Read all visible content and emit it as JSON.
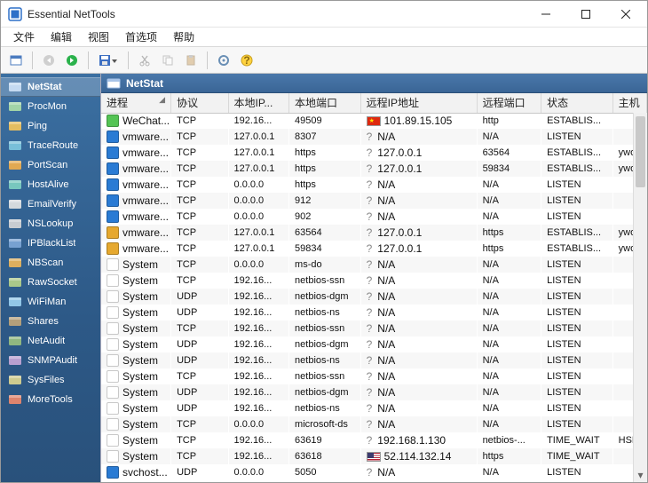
{
  "window": {
    "title": "Essential NetTools"
  },
  "menu": [
    "文件",
    "编辑",
    "视图",
    "首选项",
    "帮助"
  ],
  "panel": {
    "title": "NetStat"
  },
  "sidebar": {
    "items": [
      {
        "label": "NetStat",
        "icon": "netstat-icon",
        "active": true
      },
      {
        "label": "ProcMon",
        "icon": "procmon-icon"
      },
      {
        "label": "Ping",
        "icon": "ping-icon"
      },
      {
        "label": "TraceRoute",
        "icon": "traceroute-icon"
      },
      {
        "label": "PortScan",
        "icon": "portscan-icon"
      },
      {
        "label": "HostAlive",
        "icon": "hostalive-icon"
      },
      {
        "label": "EmailVerify",
        "icon": "emailverify-icon"
      },
      {
        "label": "NSLookup",
        "icon": "nslookup-icon"
      },
      {
        "label": "IPBlackList",
        "icon": "ipblacklist-icon"
      },
      {
        "label": "NBScan",
        "icon": "nbscan-icon"
      },
      {
        "label": "RawSocket",
        "icon": "rawsocket-icon"
      },
      {
        "label": "WiFiMan",
        "icon": "wifiman-icon"
      },
      {
        "label": "Shares",
        "icon": "shares-icon"
      },
      {
        "label": "NetAudit",
        "icon": "netaudit-icon"
      },
      {
        "label": "SNMPAudit",
        "icon": "snmpaudit-icon"
      },
      {
        "label": "SysFiles",
        "icon": "sysfiles-icon"
      },
      {
        "label": "MoreTools",
        "icon": "moretools-icon"
      }
    ]
  },
  "columns": [
    "进程",
    "协议",
    "本地IP...",
    "本地端口",
    "远程IP地址",
    "远程端口",
    "状态",
    "主机"
  ],
  "rows": [
    {
      "picon": "#54c454",
      "proc": "WeChat...",
      "proto": "TCP",
      "lip": "192.16...",
      "lport": "49509",
      "flag": "cn",
      "rip": "101.89.15.105",
      "rport": "http",
      "state": "ESTABLIS...",
      "host": ""
    },
    {
      "picon": "#2a7bd4",
      "proc": "vmware...",
      "proto": "TCP",
      "lip": "127.0.0.1",
      "lport": "8307",
      "flag": "q",
      "rip": "N/A",
      "rport": "N/A",
      "state": "LISTEN",
      "host": ""
    },
    {
      "picon": "#2a7bd4",
      "proc": "vmware...",
      "proto": "TCP",
      "lip": "127.0.0.1",
      "lport": "https",
      "flag": "q",
      "rip": "127.0.0.1",
      "rport": "63564",
      "state": "ESTABLIS...",
      "host": "ywo"
    },
    {
      "picon": "#2a7bd4",
      "proc": "vmware...",
      "proto": "TCP",
      "lip": "127.0.0.1",
      "lport": "https",
      "flag": "q",
      "rip": "127.0.0.1",
      "rport": "59834",
      "state": "ESTABLIS...",
      "host": "ywo"
    },
    {
      "picon": "#2a7bd4",
      "proc": "vmware...",
      "proto": "TCP",
      "lip": "0.0.0.0",
      "lport": "https",
      "flag": "q",
      "rip": "N/A",
      "rport": "N/A",
      "state": "LISTEN",
      "host": ""
    },
    {
      "picon": "#2a7bd4",
      "proc": "vmware...",
      "proto": "TCP",
      "lip": "0.0.0.0",
      "lport": "912",
      "flag": "q",
      "rip": "N/A",
      "rport": "N/A",
      "state": "LISTEN",
      "host": ""
    },
    {
      "picon": "#2a7bd4",
      "proc": "vmware...",
      "proto": "TCP",
      "lip": "0.0.0.0",
      "lport": "902",
      "flag": "q",
      "rip": "N/A",
      "rport": "N/A",
      "state": "LISTEN",
      "host": ""
    },
    {
      "picon": "#e6a82e",
      "proc": "vmware...",
      "proto": "TCP",
      "lip": "127.0.0.1",
      "lport": "63564",
      "flag": "q",
      "rip": "127.0.0.1",
      "rport": "https",
      "state": "ESTABLIS...",
      "host": "ywo"
    },
    {
      "picon": "#e6a82e",
      "proc": "vmware...",
      "proto": "TCP",
      "lip": "127.0.0.1",
      "lport": "59834",
      "flag": "q",
      "rip": "127.0.0.1",
      "rport": "https",
      "state": "ESTABLIS...",
      "host": "ywo"
    },
    {
      "picon": "",
      "proc": "System",
      "proto": "TCP",
      "lip": "0.0.0.0",
      "lport": "ms-do",
      "flag": "q",
      "rip": "N/A",
      "rport": "N/A",
      "state": "LISTEN",
      "host": ""
    },
    {
      "picon": "",
      "proc": "System",
      "proto": "TCP",
      "lip": "192.16...",
      "lport": "netbios-ssn",
      "flag": "q",
      "rip": "N/A",
      "rport": "N/A",
      "state": "LISTEN",
      "host": ""
    },
    {
      "picon": "",
      "proc": "System",
      "proto": "UDP",
      "lip": "192.16...",
      "lport": "netbios-dgm",
      "flag": "q",
      "rip": "N/A",
      "rport": "N/A",
      "state": "LISTEN",
      "host": ""
    },
    {
      "picon": "",
      "proc": "System",
      "proto": "UDP",
      "lip": "192.16...",
      "lport": "netbios-ns",
      "flag": "q",
      "rip": "N/A",
      "rport": "N/A",
      "state": "LISTEN",
      "host": ""
    },
    {
      "picon": "",
      "proc": "System",
      "proto": "TCP",
      "lip": "192.16...",
      "lport": "netbios-ssn",
      "flag": "q",
      "rip": "N/A",
      "rport": "N/A",
      "state": "LISTEN",
      "host": ""
    },
    {
      "picon": "",
      "proc": "System",
      "proto": "UDP",
      "lip": "192.16...",
      "lport": "netbios-dgm",
      "flag": "q",
      "rip": "N/A",
      "rport": "N/A",
      "state": "LISTEN",
      "host": ""
    },
    {
      "picon": "",
      "proc": "System",
      "proto": "UDP",
      "lip": "192.16...",
      "lport": "netbios-ns",
      "flag": "q",
      "rip": "N/A",
      "rport": "N/A",
      "state": "LISTEN",
      "host": ""
    },
    {
      "picon": "",
      "proc": "System",
      "proto": "TCP",
      "lip": "192.16...",
      "lport": "netbios-ssn",
      "flag": "q",
      "rip": "N/A",
      "rport": "N/A",
      "state": "LISTEN",
      "host": ""
    },
    {
      "picon": "",
      "proc": "System",
      "proto": "UDP",
      "lip": "192.16...",
      "lport": "netbios-dgm",
      "flag": "q",
      "rip": "N/A",
      "rport": "N/A",
      "state": "LISTEN",
      "host": ""
    },
    {
      "picon": "",
      "proc": "System",
      "proto": "UDP",
      "lip": "192.16...",
      "lport": "netbios-ns",
      "flag": "q",
      "rip": "N/A",
      "rport": "N/A",
      "state": "LISTEN",
      "host": ""
    },
    {
      "picon": "",
      "proc": "System",
      "proto": "TCP",
      "lip": "0.0.0.0",
      "lport": "microsoft-ds",
      "flag": "q",
      "rip": "N/A",
      "rport": "N/A",
      "state": "LISTEN",
      "host": ""
    },
    {
      "picon": "",
      "proc": "System",
      "proto": "TCP",
      "lip": "192.16...",
      "lport": "63619",
      "flag": "q",
      "rip": "192.168.1.130",
      "rport": "netbios-...",
      "state": "TIME_WAIT",
      "host": "HSD"
    },
    {
      "picon": "",
      "proc": "System",
      "proto": "TCP",
      "lip": "192.16...",
      "lport": "63618",
      "flag": "us",
      "rip": "52.114.132.14",
      "rport": "https",
      "state": "TIME_WAIT",
      "host": ""
    },
    {
      "picon": "#2a7bd4",
      "proc": "svchost...",
      "proto": "UDP",
      "lip": "0.0.0.0",
      "lport": "5050",
      "flag": "q",
      "rip": "N/A",
      "rport": "N/A",
      "state": "LISTEN",
      "host": ""
    }
  ]
}
